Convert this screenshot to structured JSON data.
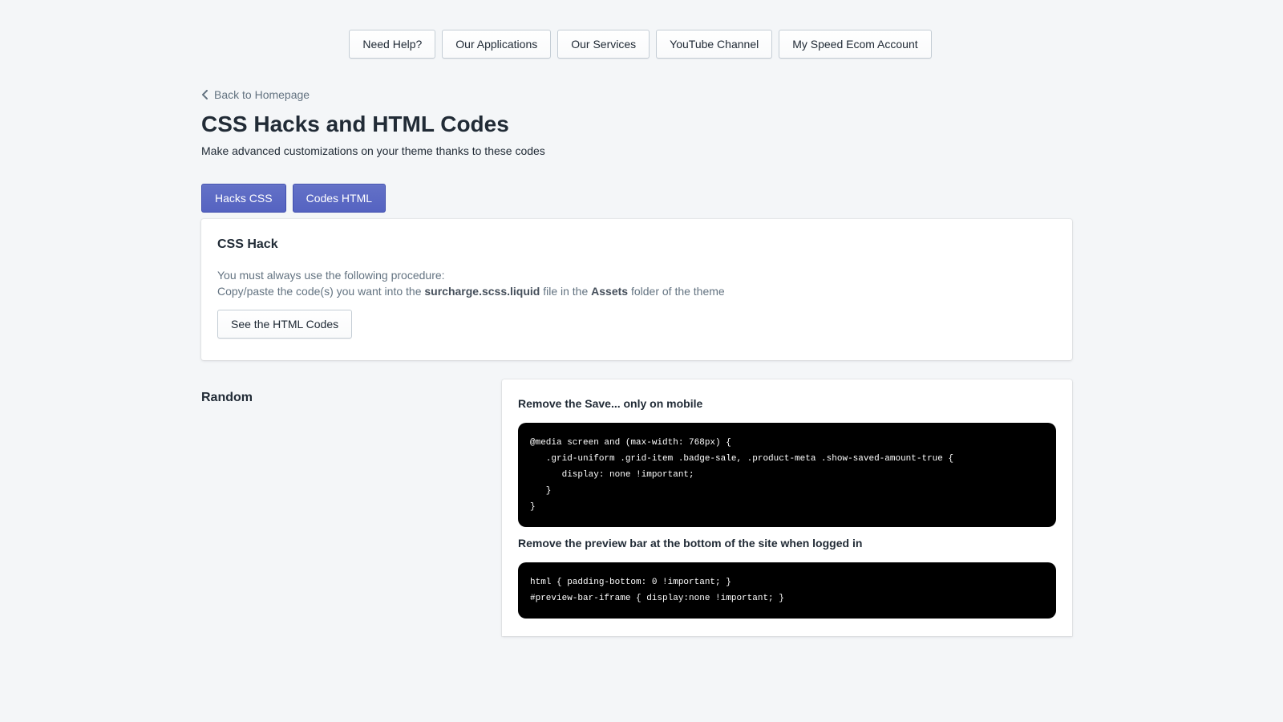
{
  "topnav": {
    "items": [
      {
        "label": "Need Help?"
      },
      {
        "label": "Our Applications"
      },
      {
        "label": "Our Services"
      },
      {
        "label": "YouTube Channel"
      },
      {
        "label": "My Speed Ecom Account"
      }
    ]
  },
  "breadcrumb": {
    "back_label": "Back to Homepage",
    "icon": "chevron-left-icon"
  },
  "header": {
    "title": "CSS Hacks and HTML Codes",
    "subtitle": "Make advanced customizations on your theme thanks to these codes"
  },
  "tabs": [
    {
      "label": "Hacks CSS",
      "active": true
    },
    {
      "label": "Codes HTML",
      "active": false
    }
  ],
  "colors": {
    "primary": "#5c6ac4",
    "background": "#f4f6f8",
    "text": "#212b36",
    "subdued": "#637381",
    "code_bg": "#000000"
  },
  "hack_card": {
    "title": "CSS Hack",
    "line1": "You must always use the following procedure:",
    "line2_prefix": "Copy/paste the code(s) you want into the ",
    "line2_file": "surcharge.scss.liquid",
    "line2_middle": " file in the ",
    "line2_folder": "Assets",
    "line2_suffix": " folder of the theme",
    "button_label": "See the HTML Codes"
  },
  "section": {
    "heading": "Random",
    "snippets": [
      {
        "title": "Remove the Save... only on mobile",
        "code": "@media screen and (max-width: 768px) {\n   .grid-uniform .grid-item .badge-sale, .product-meta .show-saved-amount-true {\n      display: none !important;\n   }\n}"
      },
      {
        "title": "Remove the preview bar at the bottom of the site when logged in",
        "code": "html { padding-bottom: 0 !important; }\n#preview-bar-iframe { display:none !important; }"
      }
    ]
  }
}
